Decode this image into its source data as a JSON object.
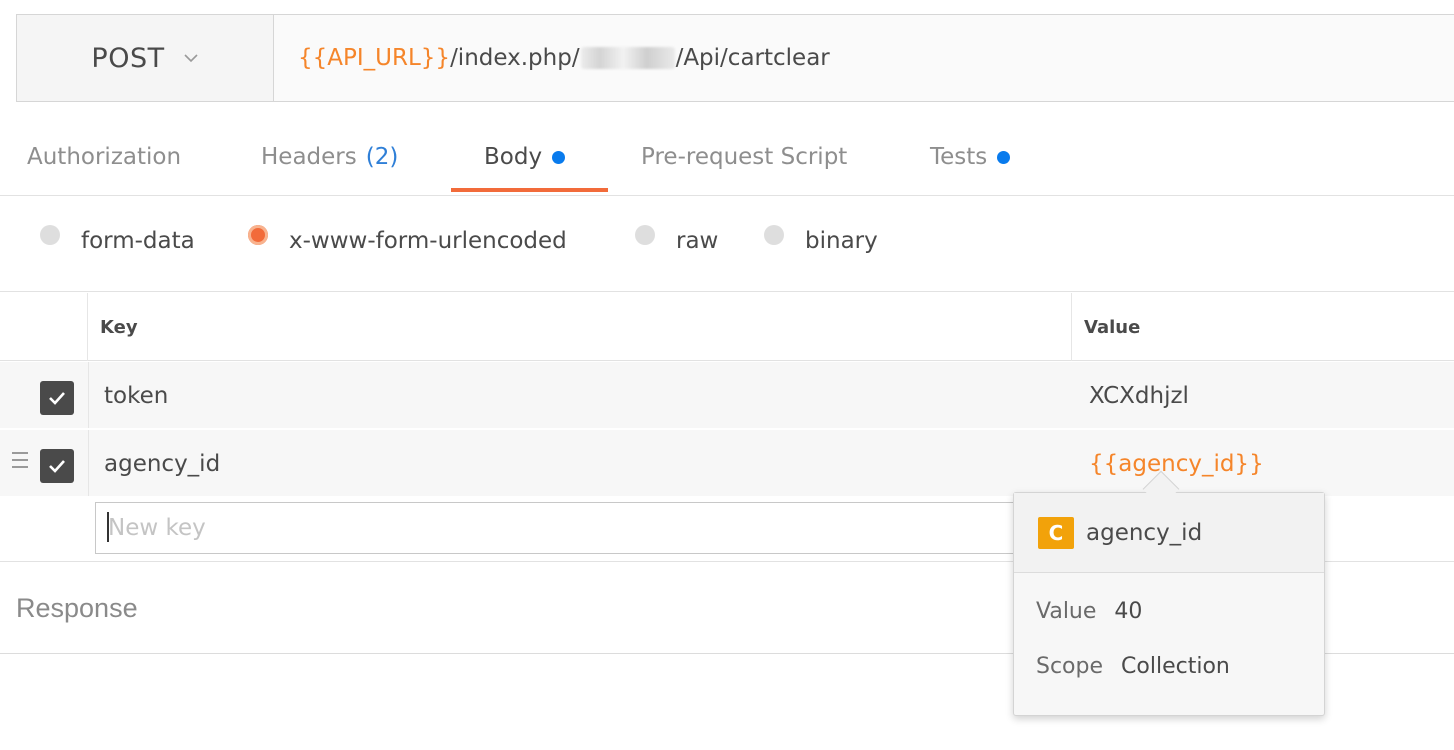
{
  "request": {
    "method": "POST",
    "url_variable": "{{API_URL}}",
    "url_prefix": "/index.php/",
    "url_suffix": "/Api/cartclear"
  },
  "tabs": [
    {
      "label": "Authorization"
    },
    {
      "label": "Headers",
      "count": "(2)"
    },
    {
      "label": "Body",
      "active": true,
      "has_dot": true
    },
    {
      "label": "Pre-request Script"
    },
    {
      "label": "Tests",
      "has_dot": true
    }
  ],
  "body_types": [
    {
      "label": "form-data",
      "selected": false
    },
    {
      "label": "x-www-form-urlencoded",
      "selected": true
    },
    {
      "label": "raw",
      "selected": false
    },
    {
      "label": "binary",
      "selected": false
    }
  ],
  "params": {
    "key_header": "Key",
    "value_header": "Value",
    "rows": [
      {
        "key": "token",
        "value": "XCXdhjzl",
        "checked": true
      },
      {
        "key": "agency_id",
        "value": "{{agency_id}}",
        "checked": true
      }
    ],
    "new_key_placeholder": "New key"
  },
  "response": {
    "label": "Response"
  },
  "variable_tooltip": {
    "scope_badge": "C",
    "name": "agency_id",
    "value_label": "Value",
    "value": "40",
    "scope_label": "Scope",
    "scope": "Collection"
  },
  "colors": {
    "accent": "#f26b3a",
    "variable": "#f5852a",
    "dot": "#097bed",
    "count": "#2f7fd7",
    "scope_badge": "#f2a20a"
  }
}
